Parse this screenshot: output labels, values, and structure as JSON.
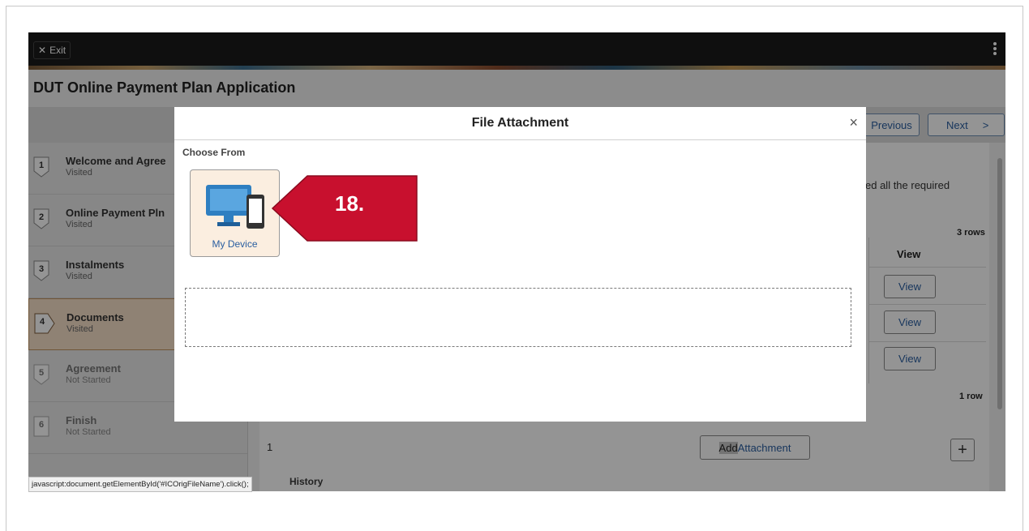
{
  "topbar": {
    "exit_label": "Exit"
  },
  "app_title": "DUT Online Payment Plan Application",
  "nav": {
    "previous": "Previous",
    "next": "Next"
  },
  "steps": [
    {
      "num": "1",
      "name": "Welcome and Agree",
      "state": "Visited"
    },
    {
      "num": "2",
      "name": "Online Payment Pln",
      "state": "Visited"
    },
    {
      "num": "3",
      "name": "Instalments",
      "state": "Visited"
    },
    {
      "num": "4",
      "name": "Documents",
      "state": "Visited"
    },
    {
      "num": "5",
      "name": "Agreement",
      "state": "Not Started"
    },
    {
      "num": "6",
      "name": "Finish",
      "state": "Not Started"
    }
  ],
  "content": {
    "partial_text": "ed all the required",
    "rows_count": "3 rows",
    "view_header": "View",
    "view_buttons": [
      "View",
      "View",
      "View"
    ],
    "row_count_2": "1 row",
    "row_index": "1",
    "add_attachment_highlight": "Add",
    "add_attachment_rest": " Attachment",
    "add_row": "+",
    "history_label": "History"
  },
  "modal": {
    "title": "File Attachment",
    "close": "×",
    "choose_from": "Choose From",
    "device_label": "My Device"
  },
  "callout": {
    "text": "18.",
    "color": "#c8102e"
  },
  "status_bar": "javascript:document.getElementById('#ICOrigFileName').click();",
  "colors": {
    "accent_blue": "#2a5ea0",
    "active_step": "#f7e0c9",
    "callout_red": "#c8102e",
    "device_icon": "#2f7fc1"
  }
}
